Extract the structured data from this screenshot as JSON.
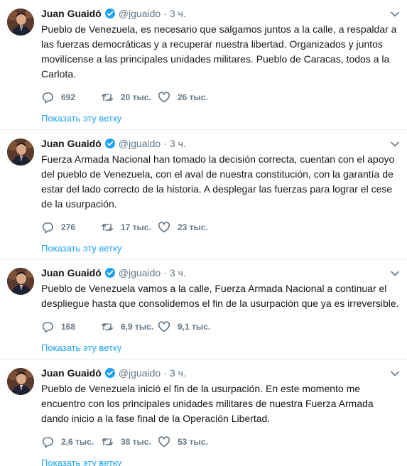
{
  "colors": {
    "link": "#1da1f2",
    "meta": "#657786",
    "text": "#14171a",
    "verified": "#1da1f2",
    "divider": "#e6ecf0"
  },
  "tweets": [
    {
      "name": "Juan Guaidó",
      "handle": "@jguaido",
      "time": "3 ч.",
      "text": "Pueblo de Venezuela, es necesario que salgamos juntos a la calle, a respaldar a las fuerzas democráticas y a recuperar nuestra libertad. Organizados y juntos movilícense a las principales unidades militares. Pueblo de Caracas, todos a la Carlota.",
      "replies": "692",
      "retweets": "20 тыс.",
      "likes": "26 тыс.",
      "thread": "Показать эту ветку"
    },
    {
      "name": "Juan Guaidó",
      "handle": "@jguaido",
      "time": "3 ч.",
      "text": "Fuerza Armada Nacional han tomado la decisión correcta, cuentan con el apoyo del pueblo de Venezuela, con el aval de nuestra constitución, con la garantía de estar del lado correcto de la historia. A desplegar las fuerzas para lograr el cese de la usurpación.",
      "replies": "276",
      "retweets": "17 тыс.",
      "likes": "23 тыс.",
      "thread": "Показать эту ветку"
    },
    {
      "name": "Juan Guaidó",
      "handle": "@jguaido",
      "time": "3 ч.",
      "text": "Pueblo de Venezuela vamos a la calle, Fuerza Armada Nacional a continuar el despliegue hasta que consolidemos el fin de la usurpación que ya es irreversible.",
      "replies": "168",
      "retweets": "6,9 тыс.",
      "likes": "9,1 тыс.",
      "thread": "Показать эту ветку"
    },
    {
      "name": "Juan Guaidó",
      "handle": "@jguaido",
      "time": "3 ч.",
      "text": "Pueblo de Venezuela inició el fin de la usurpación. En este momento me encuentro con los principales unidades militares de nuestra Fuerza Armada dando inicio a la fase final de la Operación Libertad.",
      "replies": "2,6 тыс.",
      "retweets": "38 тыс.",
      "likes": "53 тыс.",
      "thread": "Показать эту ветку"
    }
  ]
}
